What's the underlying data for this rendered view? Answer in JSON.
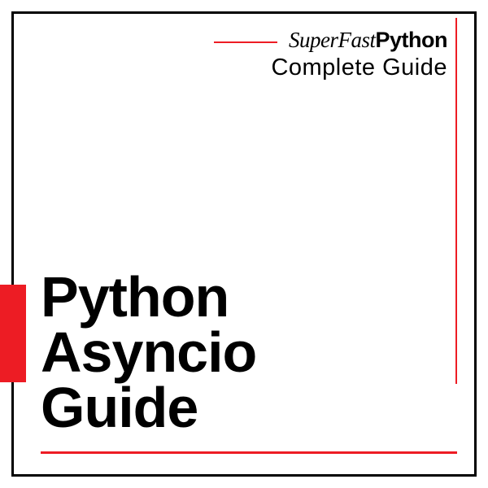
{
  "header": {
    "brand_prefix": "SuperFast",
    "brand_suffix": "Python",
    "subtitle": "Complete Guide"
  },
  "main": {
    "line1": "Python",
    "line2": "Asyncio",
    "line3": "Guide"
  },
  "colors": {
    "accent": "#ed1c24",
    "text": "#000000"
  }
}
